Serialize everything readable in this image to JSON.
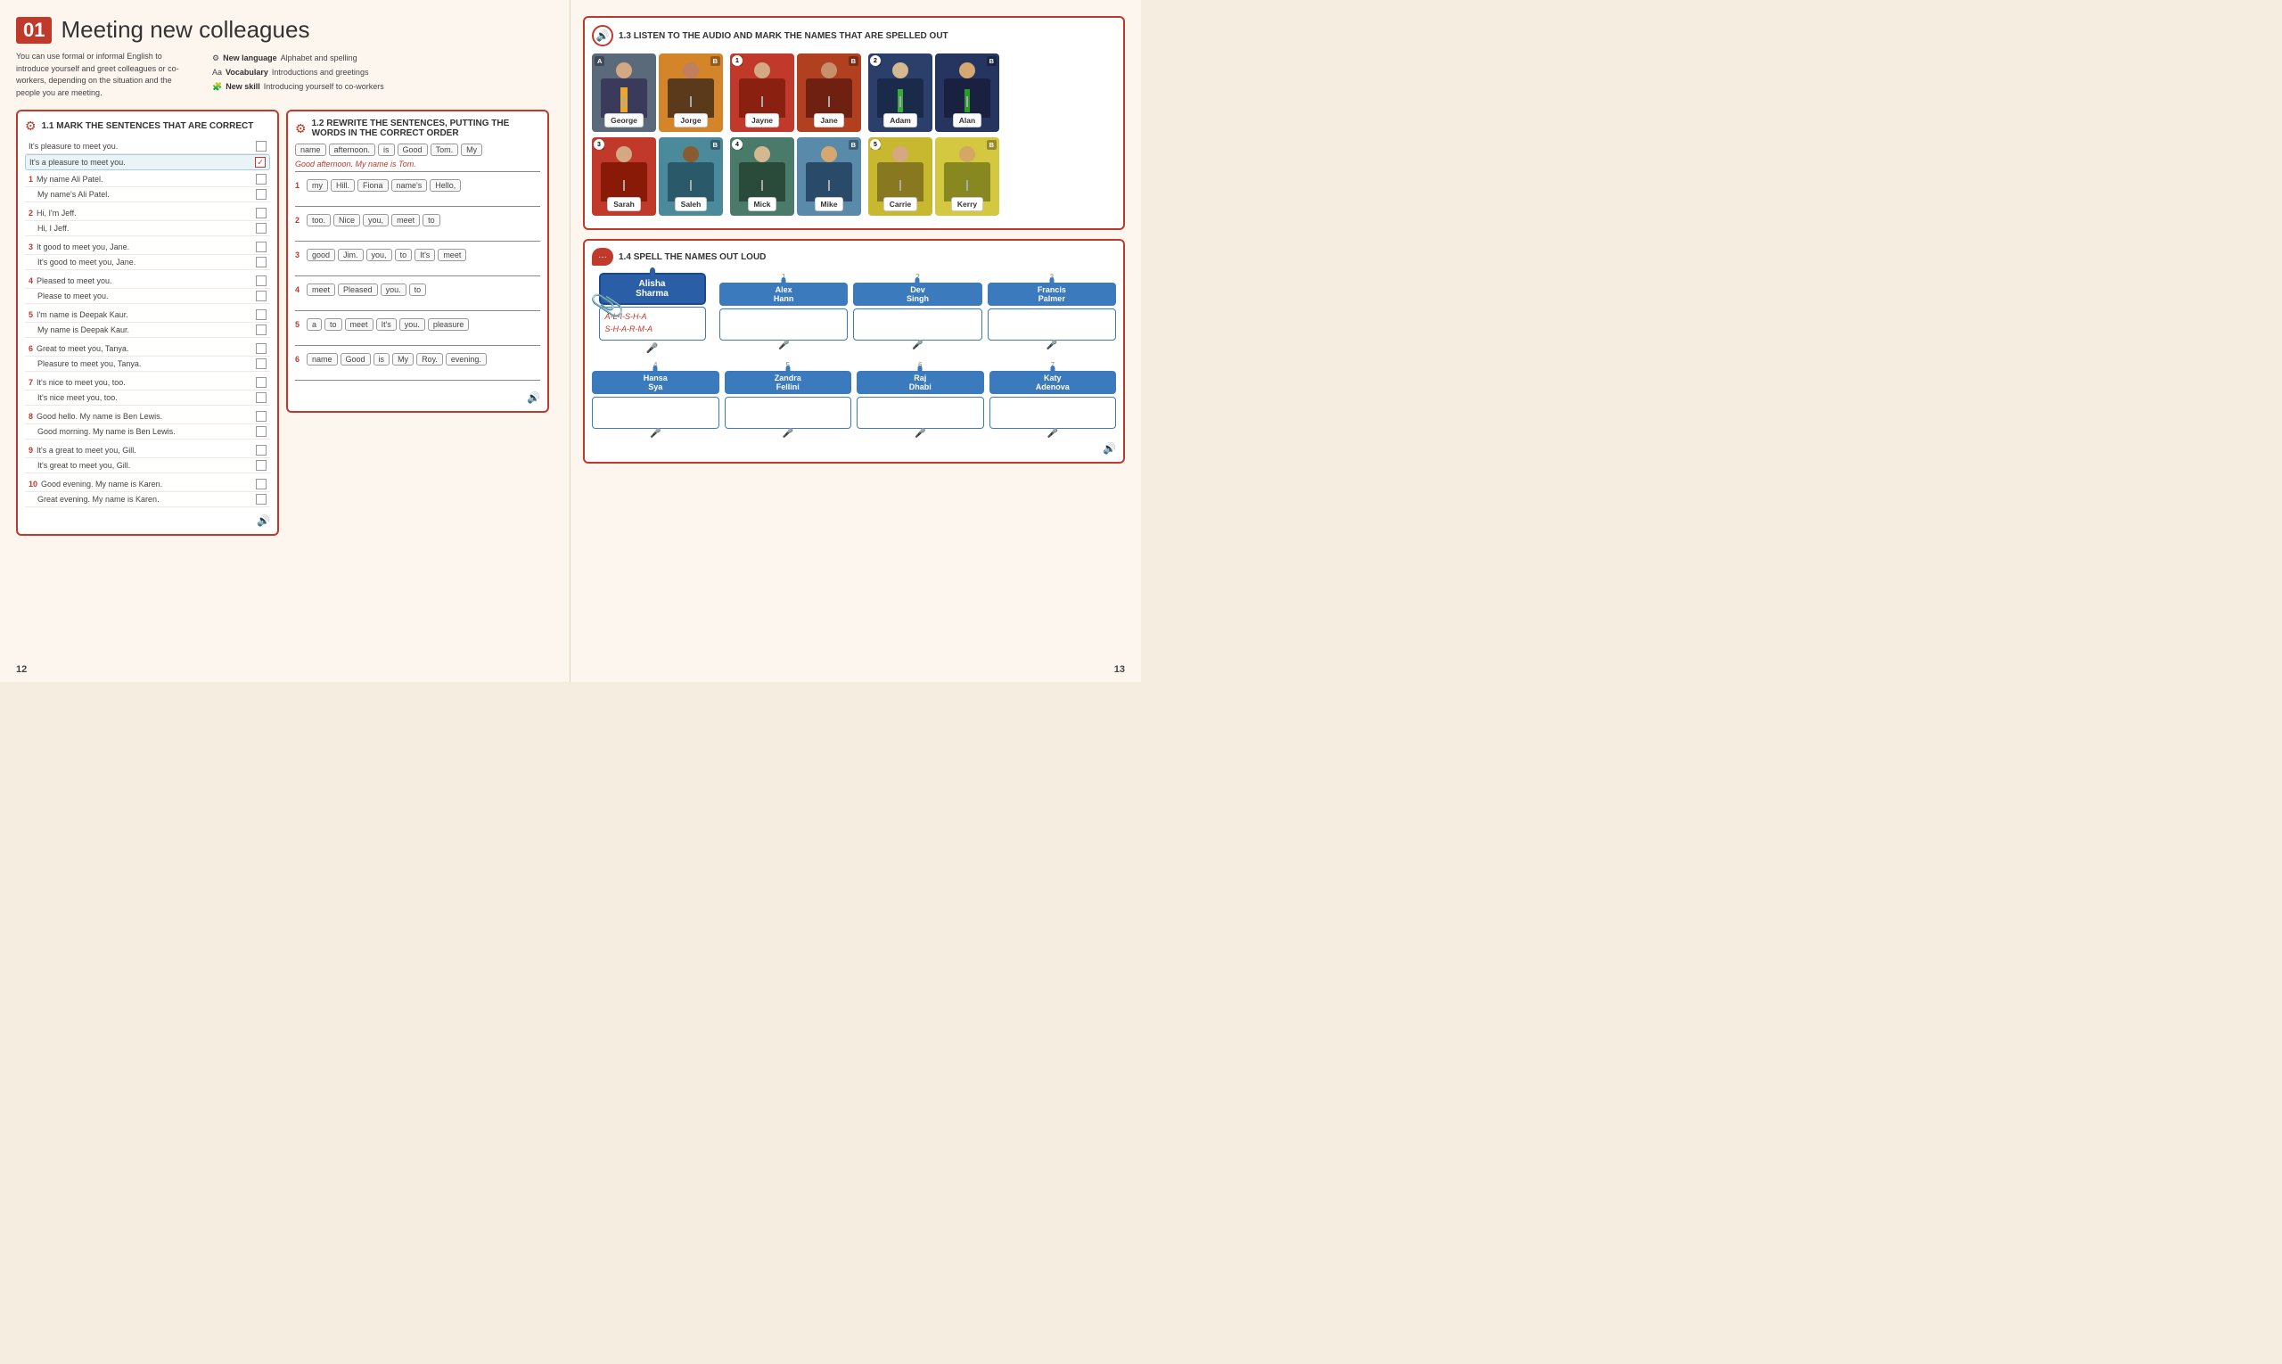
{
  "lesson": {
    "number": "01",
    "title": "Meeting new colleagues",
    "intro_text": "You can use formal or informal English to introduce yourself and greet colleagues or co-workers, depending on the situation and the people you are meeting.",
    "new_language_label": "New language",
    "new_language_value": "Alphabet and spelling",
    "vocabulary_label": "Vocabulary",
    "vocabulary_value": "Introductions and greetings",
    "new_skill_label": "New skill",
    "new_skill_value": "Introducing yourself to co-workers"
  },
  "exercise_11": {
    "number": "1.1",
    "title": "MARK THE SENTENCES THAT ARE CORRECT",
    "example_sentences": [
      "It's pleasure to meet you.",
      "It's a pleasure to meet you."
    ],
    "items": [
      {
        "num": "1",
        "a": "My name Ali Patel.",
        "b": "My name's Ali Patel."
      },
      {
        "num": "2",
        "a": "Hi, I'm Jeff.",
        "b": "Hi, I Jeff."
      },
      {
        "num": "3",
        "a": "It good to meet you, Jane.",
        "b": "It's good to meet you, Jane."
      },
      {
        "num": "4",
        "a": "Pleased to meet you.",
        "b": "Please to meet you."
      },
      {
        "num": "5",
        "a": "I'm name is Deepak Kaur.",
        "b": "My name is Deepak Kaur."
      },
      {
        "num": "6",
        "a": "Great to meet you, Tanya.",
        "b": "Pleasure to meet you, Tanya."
      },
      {
        "num": "7",
        "a": "It's nice to meet you, too.",
        "b": "It's nice meet you, too."
      },
      {
        "num": "8",
        "a": "Good hello. My name is Ben Lewis.",
        "b": "Good morning. My name is Ben Lewis."
      },
      {
        "num": "9",
        "a": "It's a great to meet you, Gill.",
        "b": "It's great to meet you, Gill."
      },
      {
        "num": "10",
        "a": "Good evening. My name is Karen.",
        "b": "Great evening. My name is Karen."
      }
    ]
  },
  "exercise_12": {
    "number": "1.2",
    "title": "REWRITE THE SENTENCES, PUTTING THE WORDS IN THE CORRECT ORDER",
    "example_words": [
      "name",
      "afternoon.",
      "is",
      "Good",
      "Tom.",
      "My"
    ],
    "example_answer": "Good afternoon. My name is Tom.",
    "items": [
      {
        "num": "1",
        "words": [
          "my",
          "Hill.",
          "Fiona",
          "name's",
          "Hello,"
        ],
        "answer": ""
      },
      {
        "num": "2",
        "words": [
          "too.",
          "Nice",
          "you,",
          "meet",
          "to"
        ],
        "answer": ""
      },
      {
        "num": "3",
        "words": [
          "good",
          "Jim.",
          "you,",
          "to",
          "It's",
          "meet"
        ],
        "answer": ""
      },
      {
        "num": "4",
        "words": [
          "meet",
          "Pleased",
          "you.",
          "to"
        ],
        "answer": ""
      },
      {
        "num": "5",
        "words": [
          "a",
          "to",
          "meet",
          "It's",
          "you.",
          "pleasure"
        ],
        "answer": ""
      },
      {
        "num": "6",
        "words": [
          "name",
          "Good",
          "is",
          "My",
          "Roy.",
          "evening."
        ],
        "answer": ""
      }
    ]
  },
  "exercise_13": {
    "number": "1.3",
    "title": "LISTEN TO THE AUDIO AND MARK THE NAMES THAT ARE SPELLED OUT",
    "row1": [
      {
        "a_name": "George",
        "b_name": "Jorge",
        "a_color": "#5a6a7a",
        "b_color": "#d4852a"
      },
      {
        "num": "1",
        "a_name": "Jayne",
        "b_name": "Jane",
        "a_color": "#c0392b",
        "b_color": "#c0392b"
      },
      {
        "num": "2",
        "a_name": "Adam",
        "b_name": "Alan",
        "a_color": "#2c3e6a",
        "b_color": "#2c3e6a"
      }
    ],
    "row2": [
      {
        "num": "3",
        "a_name": "Sarah",
        "b_name": "Saleh",
        "a_color": "#c0392b",
        "b_color": "#5a8a9a"
      },
      {
        "num": "4",
        "a_name": "Mick",
        "b_name": "Mike",
        "a_color": "#5a7a6a",
        "b_color": "#6a8aaa"
      },
      {
        "num": "5",
        "a_name": "Carrie",
        "b_name": "Kerry",
        "a_color": "#c8b830",
        "b_color": "#c8c860"
      }
    ]
  },
  "exercise_14": {
    "number": "1.4",
    "title": "SPELL THE NAMES OUT LOUD",
    "example": {
      "name": "Alisha\nSharma",
      "spelling": "A-L-I-S-H-A\nS-H-A-R-M-A"
    },
    "items": [
      {
        "num": "1",
        "name": "Alex\nHann",
        "spelling": ""
      },
      {
        "num": "2",
        "name": "Dev\nSingh",
        "spelling": ""
      },
      {
        "num": "3",
        "name": "Francis\nPalmer",
        "spelling": ""
      },
      {
        "num": "4",
        "name": "Hansa\nSya",
        "spelling": ""
      },
      {
        "num": "5",
        "name": "Zandra\nFellini",
        "spelling": ""
      },
      {
        "num": "6",
        "name": "Raj\nDhabi",
        "spelling": ""
      },
      {
        "num": "7",
        "name": "Katy\nAdenova",
        "spelling": ""
      }
    ]
  },
  "page_numbers": {
    "left": "12",
    "right": "13"
  }
}
